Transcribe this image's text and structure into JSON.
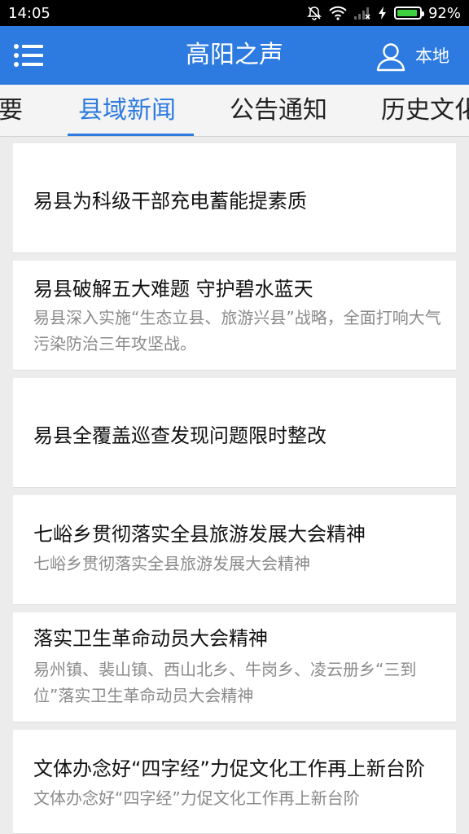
{
  "status_bar": {
    "time": "14:05",
    "battery_percent": "92%",
    "battery_level": 0.92,
    "icons": [
      "bell-off-icon",
      "wifi-icon",
      "signal-no-sim-icon",
      "charging-icon",
      "battery-icon"
    ]
  },
  "app_bar": {
    "title": "高阳之声",
    "local_label": "本地",
    "accent_color": "#2d7be0"
  },
  "tabs": [
    {
      "label": "摘要",
      "active": false
    },
    {
      "label": "县域新闻",
      "active": true
    },
    {
      "label": "公告通知",
      "active": false
    },
    {
      "label": "历史文化",
      "active": false
    }
  ],
  "news": [
    {
      "title": "易县为科级干部充电蓄能提素质",
      "summary": ""
    },
    {
      "title": "易县破解五大难题 守护碧水蓝天",
      "summary": "易县深入实施“生态立县、旅游兴县”战略，全面打响大气污染防治三年攻坚战。"
    },
    {
      "title": "易县全覆盖巡查发现问题限时整改",
      "summary": ""
    },
    {
      "title": "七峪乡贯彻落实全县旅游发展大会精神",
      "summary": "七峪乡贯彻落实全县旅游发展大会精神"
    },
    {
      "title": "落实卫生革命动员大会精神",
      "summary": "易州镇、裴山镇、西山北乡、牛岗乡、凌云册乡“三到位”落实卫生革命动员大会精神"
    },
    {
      "title": "文体办念好“四字经”力促文化工作再上新台阶",
      "summary": "文体办念好“四字经”力促文化工作再上新台阶"
    }
  ]
}
